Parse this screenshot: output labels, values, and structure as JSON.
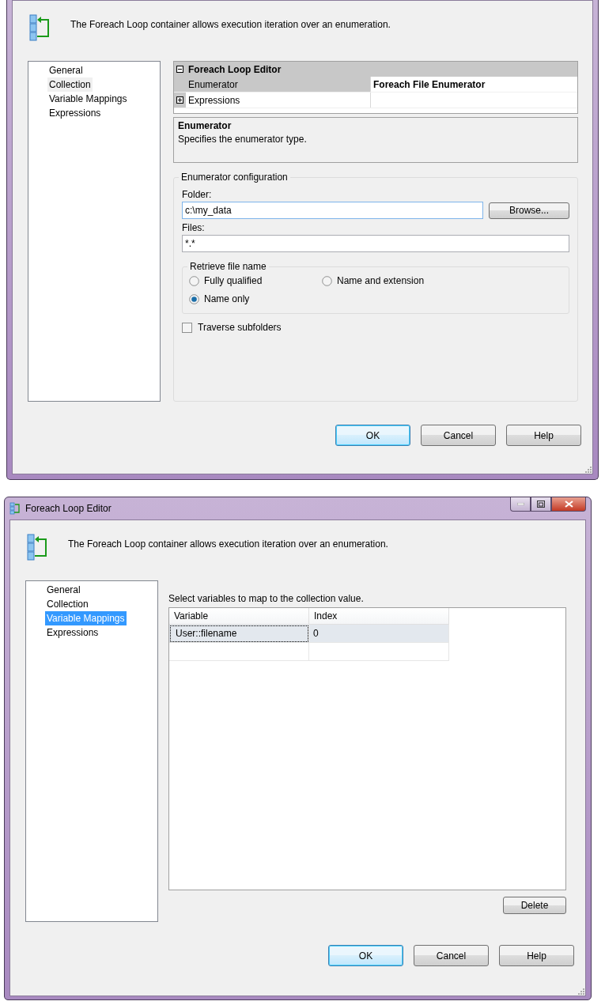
{
  "collection_dialog": {
    "description": "The Foreach Loop container allows execution iteration over an enumeration.",
    "nav": {
      "focused": false,
      "items": [
        {
          "label": "General",
          "selected": false
        },
        {
          "label": "Collection",
          "selected": true
        },
        {
          "label": "Variable Mappings",
          "selected": false
        },
        {
          "label": "Expressions",
          "selected": false
        }
      ]
    },
    "property_grid": {
      "category": "Foreach Loop Editor",
      "expanded": true,
      "rows": [
        {
          "name": "Enumerator",
          "value": "Foreach File Enumerator",
          "selected": true
        },
        {
          "name": "Expressions",
          "selected": false,
          "expanded": false
        }
      ]
    },
    "help_panel": {
      "title": "Enumerator",
      "text": "Specifies the enumerator type."
    },
    "configuration": {
      "title": "Enumerator configuration",
      "folder_label": "Folder:",
      "folder_value": "c:\\my_data",
      "browse_button": "Browse...",
      "files_label": "Files:",
      "files_value": "*.*",
      "retrieve_group": {
        "title": "Retrieve file name",
        "options": [
          {
            "label": "Fully qualified",
            "selected": false
          },
          {
            "label": "Name and extension",
            "selected": false
          },
          {
            "label": "Name only",
            "selected": true
          }
        ]
      },
      "traverse": {
        "label": "Traverse subfolders",
        "checked": false
      }
    },
    "buttons": [
      {
        "label": "OK",
        "default": true
      },
      {
        "label": "Cancel",
        "default": false
      },
      {
        "label": "Help",
        "default": false
      }
    ]
  },
  "mappings_dialog": {
    "title": "Foreach Loop Editor",
    "description": "The Foreach Loop container allows execution iteration over an enumeration.",
    "nav": {
      "focused": true,
      "items": [
        {
          "label": "General",
          "selected": false
        },
        {
          "label": "Collection",
          "selected": false
        },
        {
          "label": "Variable Mappings",
          "selected": true
        },
        {
          "label": "Expressions",
          "selected": false
        }
      ]
    },
    "instruction": "Select variables to map to the collection value.",
    "table": {
      "columns": [
        "Variable",
        "Index"
      ],
      "rows": [
        {
          "cells": [
            "User::filename",
            "0"
          ],
          "selected": true
        }
      ]
    },
    "delete_button": "Delete",
    "buttons": [
      {
        "label": "OK",
        "default": true
      },
      {
        "label": "Cancel",
        "default": false
      },
      {
        "label": "Help",
        "default": false
      }
    ]
  }
}
